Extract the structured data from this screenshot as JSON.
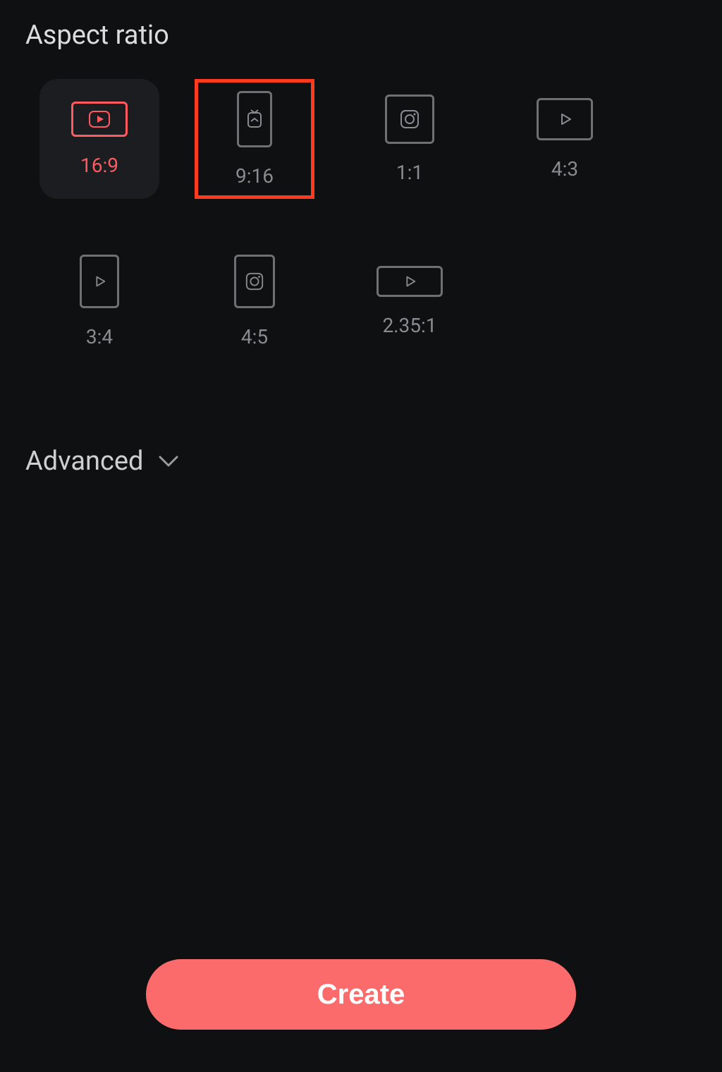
{
  "title": "Aspect ratio",
  "ratios": {
    "r16_9": {
      "label": "16:9",
      "icon": "youtube-play",
      "selected": true,
      "highlighted": false
    },
    "r9_16": {
      "label": "9:16",
      "icon": "igtv",
      "selected": false,
      "highlighted": true
    },
    "r1_1": {
      "label": "1:1",
      "icon": "instagram",
      "selected": false,
      "highlighted": false
    },
    "r4_3": {
      "label": "4:3",
      "icon": "play",
      "selected": false,
      "highlighted": false
    },
    "r3_4": {
      "label": "3:4",
      "icon": "play",
      "selected": false,
      "highlighted": false
    },
    "r4_5": {
      "label": "4:5",
      "icon": "instagram",
      "selected": false,
      "highlighted": false
    },
    "r235_1": {
      "label": "2.35:1",
      "icon": "play",
      "selected": false,
      "highlighted": false
    }
  },
  "advanced_label": "Advanced",
  "create_label": "Create",
  "colors": {
    "accent": "#ff5a5f",
    "highlight_border": "#ff3b1f",
    "create_bg": "#fc6b6b",
    "bg": "#0f1012"
  }
}
